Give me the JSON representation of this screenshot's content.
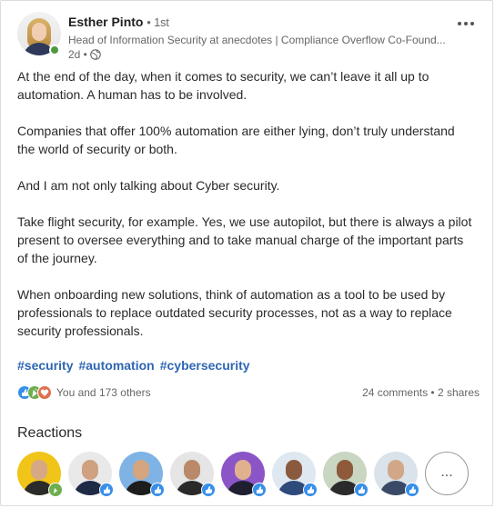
{
  "post": {
    "author": {
      "name": "Esther Pinto",
      "degree": "• 1st",
      "headline": "Head of Information Security at anecdotes | Compliance Overflow Co-Found...",
      "time": "2d •"
    },
    "paragraphs": [
      "At the end of the day, when it comes to security, we can’t leave it all up to automation. A human has to be involved.",
      "Companies that offer 100% automation are either lying, don’t truly understand the world of security or both.",
      "And I am not only talking about Cyber security.",
      "Take flight security, for example. Yes, we use autopilot, but there is always a pilot present to oversee everything and to take manual charge of the important parts of the journey.",
      "When onboarding new solutions, think of automation as a tool to be used by professionals to replace outdated security processes, not as a way to replace security professionals."
    ],
    "hashtags": [
      "#security",
      "#automation",
      "#cybersecurity"
    ],
    "social": {
      "reactions_text": "You and 173 others",
      "comments_shares": "24 comments • 2 shares"
    }
  },
  "reactions_section": {
    "title": "Reactions",
    "reactors": [
      {
        "bg": "#f0c419",
        "face": "#d6a884",
        "body": "#2b2b2b",
        "badge": "celebrate"
      },
      {
        "bg": "#e9e9e9",
        "face": "#cfa181",
        "body": "#1f2a44",
        "badge": "like"
      },
      {
        "bg": "#7fb3e6",
        "face": "#d4a57f",
        "body": "#1d1d1d",
        "badge": "like"
      },
      {
        "bg": "#e5e5e5",
        "face": "#b9896a",
        "body": "#2a2a2a",
        "badge": "like"
      },
      {
        "bg": "#8b55c8",
        "face": "#e0b08f",
        "body": "#1f1f2f",
        "badge": "like"
      },
      {
        "bg": "#dfe8f0",
        "face": "#8a5a3f",
        "body": "#2e4a7a",
        "badge": "like"
      },
      {
        "bg": "#c8d6c2",
        "face": "#8e5a3a",
        "body": "#2b2b2b",
        "badge": "like"
      },
      {
        "bg": "#dbe3ea",
        "face": "#d1a788",
        "body": "#3a4a66",
        "badge": "like"
      }
    ],
    "more_label": "..."
  },
  "colors": {
    "link": "#2f66b3",
    "like": "#378fe9",
    "celebrate": "#6dae4f",
    "love": "#df704d"
  }
}
